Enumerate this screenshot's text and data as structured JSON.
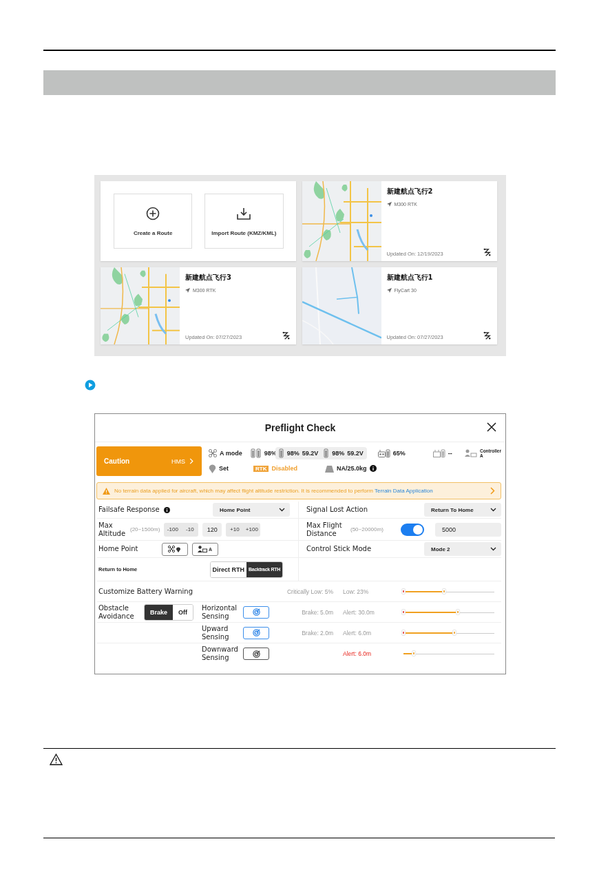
{
  "routes": {
    "actions": [
      {
        "label": "Create a Route"
      },
      {
        "label": "Import Route (KMZ/KML)"
      }
    ],
    "cards": [
      {
        "name": "新建航点飞行2",
        "aircraft": "M300 RTK",
        "updated": "Updated On: 12/19/2023"
      },
      {
        "name": "新建航点飞行3",
        "aircraft": "M300 RTK",
        "updated": "Updated On: 07/27/2023"
      },
      {
        "name": "新建航点飞行1",
        "aircraft": "FlyCart 30",
        "updated": "Updated On: 07/27/2023"
      }
    ]
  },
  "preflight": {
    "title": "Preflight Check",
    "caution": {
      "label": "Caution",
      "link": "HMS"
    },
    "status_top": [
      {
        "kind": "aircraft",
        "text": "A mode"
      },
      {
        "kind": "battery",
        "text": "98%"
      },
      {
        "kind": "battery-pack",
        "text": "98%",
        "voltage": "59.2V"
      },
      {
        "kind": "battery-pack",
        "text": "98%",
        "voltage": "59.2V"
      },
      {
        "kind": "remote",
        "text": "65%"
      },
      {
        "kind": "station",
        "text": "--"
      },
      {
        "kind": "controller",
        "text": "Controller",
        "sub": "A"
      }
    ],
    "status_bottom": [
      {
        "kind": "home",
        "text": "Set"
      },
      {
        "kind": "rtk",
        "badge": "RTK",
        "text": "Disabled"
      },
      {
        "kind": "weight",
        "text": "NA/25.0kg"
      }
    ],
    "banner": {
      "text": "No terrain data applied for aircraft, which may affect flight altitude restriction. It is recommended to perform",
      "link": "Terrain Data Application"
    },
    "failsafe": {
      "label": "Failsafe Response",
      "value": "Home Point"
    },
    "signal_lost": {
      "label": "Signal Lost Action",
      "value": "Return To Home"
    },
    "max_altitude": {
      "label": "Max Altitude",
      "range": "(20~1500m)",
      "steps_down": [
        "-100",
        "-10"
      ],
      "value": "120",
      "steps_up": [
        "+10",
        "+100"
      ]
    },
    "max_distance": {
      "label": "Max Flight Distance",
      "range": "(50~20000m)",
      "on": true,
      "value": "5000"
    },
    "home_point": {
      "label": "Home Point",
      "controller_tag": "A"
    },
    "stick_mode": {
      "label": "Control Stick Mode",
      "value": "Mode 2"
    },
    "return_home": {
      "label": "Return to Home",
      "options": [
        {
          "label": "Direct RTH",
          "selected": false
        },
        {
          "label": "Backtrack RTH",
          "selected": true
        }
      ]
    },
    "battery_warning": {
      "label": "Customize Battery Warning",
      "critical": "Critically Low:  5%",
      "low": "Low: 23%",
      "level": 0.45,
      "lower_mark": true
    },
    "obstacle": {
      "label": "Obstacle Avoidance",
      "options": [
        {
          "label": "Brake",
          "selected": true
        },
        {
          "label": "Off",
          "selected": false
        }
      ]
    },
    "sensing": [
      {
        "label": "Horizontal Sensing",
        "on": true,
        "brake": "Brake: 5.0m",
        "alert": "Alert: 30.0m",
        "alert_warning": false,
        "level": 0.6,
        "lower_mark": true
      },
      {
        "label": "Upward Sensing",
        "on": true,
        "brake": "Brake: 2.0m",
        "alert": "Alert: 6.0m",
        "alert_warning": false,
        "level": 0.56,
        "lower_mark": true
      },
      {
        "label": "Downward Sensing",
        "on": false,
        "alert": "Alert: 6.0m",
        "alert_warning": true,
        "level": 0.11,
        "lower_mark": false
      }
    ]
  }
}
